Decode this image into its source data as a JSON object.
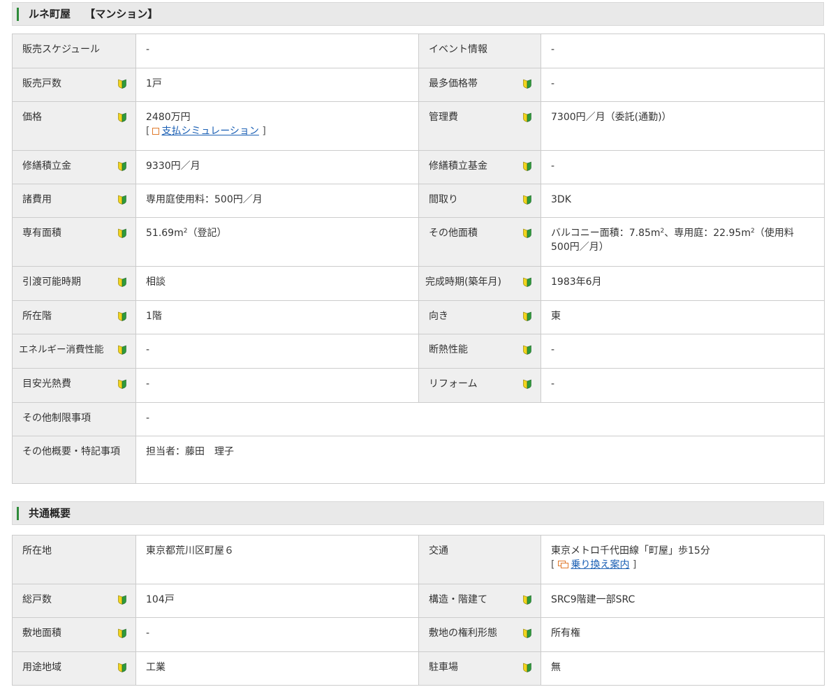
{
  "section1": {
    "title": "ルネ町屋　 【マンション】",
    "rows": [
      {
        "l1": "販売スケジュール",
        "v1": "-",
        "l2": "イベント情報",
        "v2": "-"
      },
      {
        "l1": "販売戸数",
        "v1": "1戸",
        "l2": "最多価格帯",
        "v2": "-"
      },
      {
        "l1": "価格",
        "v1": "2480万円",
        "l2": "管理費",
        "v2": "7300円／月（委託(通勤)）"
      },
      {
        "l1": "修繕積立金",
        "v1": "9330円／月",
        "l2": "修繕積立基金",
        "v2": "-"
      },
      {
        "l1": "諸費用",
        "v1": "専用庭使用料：500円／月",
        "l2": "間取り",
        "v2": "3DK"
      },
      {
        "l1": "専有面積",
        "v1a": "51.69m",
        "v1sup": "2",
        "v1b": "（登記）",
        "l2": "その他面積",
        "v2a": "バルコニー面積：7.85m",
        "v2sup": "2",
        "v2b": "、専用庭：22.95m",
        "v2sup2": "2",
        "v2c": "（使用料500円／月）"
      },
      {
        "l1": "引渡可能時期",
        "v1": "相談",
        "l2": "完成時期(築年月)",
        "v2": "1983年6月"
      },
      {
        "l1": "所在階",
        "v1": "1階",
        "l2": "向き",
        "v2": "東"
      },
      {
        "l1": "エネルギー消費性能",
        "v1": "-",
        "l2": "断熱性能",
        "v2": "-"
      },
      {
        "l1": "目安光熱費",
        "v1": "-",
        "l2": "リフォーム",
        "v2": "-"
      },
      {
        "l1": "その他制限事項",
        "v1": "-"
      },
      {
        "l1": "その他概要・特記事項",
        "v1": "担当者：藤田　理子"
      }
    ],
    "sim_link": "支払シミュレーション",
    "bracket_open": "[",
    "bracket_close": "]"
  },
  "section2": {
    "title": "共通概要",
    "rows": [
      {
        "l1": "所在地",
        "v1": "東京都荒川区町屋６",
        "l2": "交通",
        "v2": "東京メトロ千代田線「町屋」歩15分"
      },
      {
        "l1": "総戸数",
        "v1": "104戸",
        "l2": "構造・階建て",
        "v2": "SRC9階建一部SRC"
      },
      {
        "l1": "敷地面積",
        "v1": "-",
        "l2": "敷地の権利形態",
        "v2": "所有権"
      },
      {
        "l1": "用途地域",
        "v1": "工業",
        "l2": "駐車場",
        "v2": "無"
      }
    ],
    "transfer_link": "乗り換え案内",
    "bracket_open": "[",
    "bracket_close": "]"
  },
  "icons": {
    "beginner_mark": "wakaba-icon",
    "link_square": "window-icon",
    "train": "train-icon"
  },
  "colors": {
    "accent": "#2e8b3a",
    "label_bg": "#efefef",
    "border": "#cccccc",
    "link": "#1a5fb4"
  }
}
